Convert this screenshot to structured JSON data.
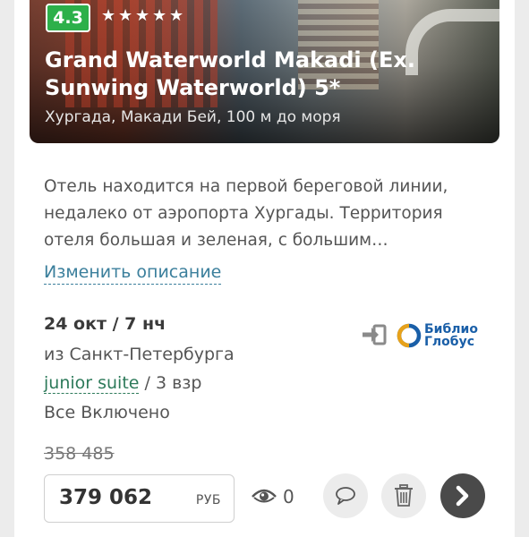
{
  "hotel": {
    "rating": "4.3",
    "stars": 5,
    "name": "Grand Waterworld Makadi (Ex. Sunwing Waterworld) 5*",
    "location": "Хургада, Макади Бей, 100 м до моря"
  },
  "description": {
    "text": "Отель находится на первой береговой линии, недалеко от аэропорта Хургады. Территория отеля большая и зеленая, с большим…",
    "edit_label": "Изменить описание"
  },
  "trip": {
    "date": "24 окт / 7 нч",
    "departure": "из Санкт-Петербурга",
    "room_type": "junior suite",
    "guests": " / 3 взр",
    "meal": "Все Включено"
  },
  "operator": {
    "name_line1": "Библио",
    "name_line2": "Глобус",
    "brand_color": "#1a5fa8"
  },
  "price": {
    "old": "358 485",
    "current": "379 062",
    "currency": "РУБ"
  },
  "views": {
    "count": "0"
  },
  "colors": {
    "rating_badge": "#2db04a",
    "link": "#3b7f9c",
    "room_link": "#2d7a5a",
    "next_button": "#4a4a4a"
  }
}
